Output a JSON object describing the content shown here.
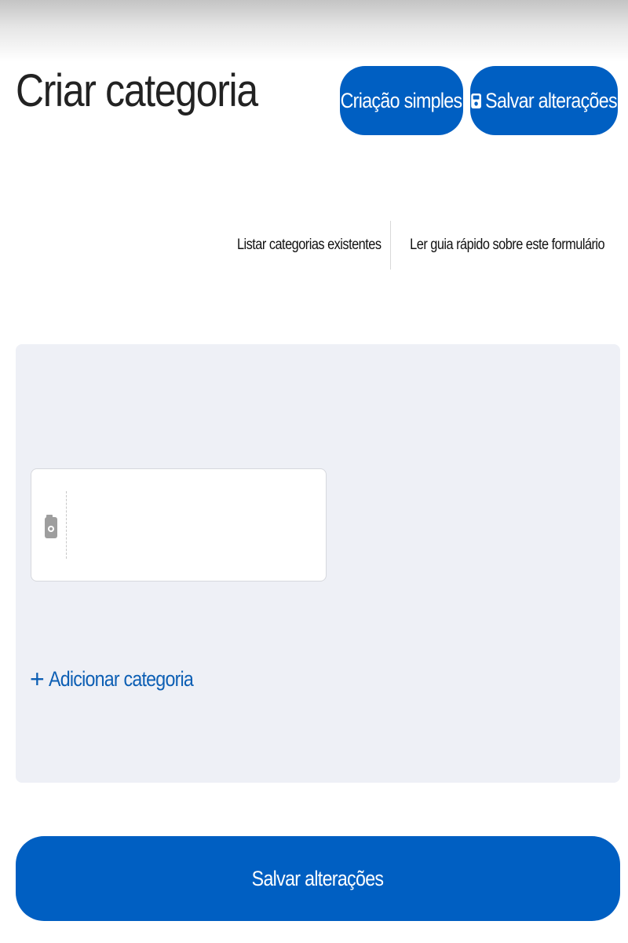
{
  "header": {
    "title": "Criar categoria",
    "simple_mode_label": "Criação simples",
    "save_label": "Salvar alterações",
    "save_icon": "floppy-disk-icon"
  },
  "links": {
    "list_existing": "Listar categorias existentes",
    "quick_guide": "Ler guia rápido sobre este formulário"
  },
  "form": {
    "image_icon": "camera-icon",
    "add_category_label": "Adicionar categoria",
    "add_icon": "plus-icon"
  },
  "footer": {
    "save_label": "Salvar alterações"
  },
  "colors": {
    "primary": "#005fc2",
    "link": "#0d5fb4",
    "panel_bg": "#eef0f6"
  }
}
